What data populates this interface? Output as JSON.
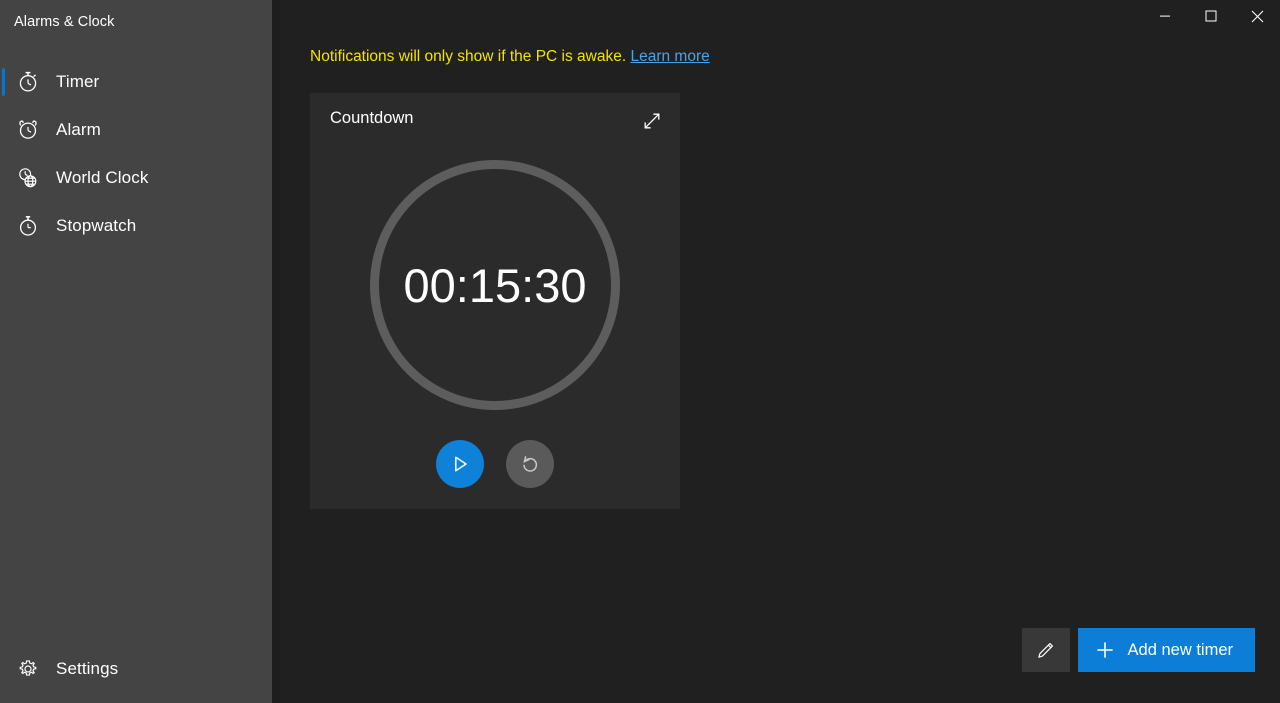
{
  "app": {
    "title": "Alarms & Clock",
    "accent_color": "#0078d7",
    "window_background": "#202020",
    "sidebar_background": "#444444",
    "card_background": "#2b2b2b"
  },
  "window_controls": {
    "minimize": {
      "name": "minimize",
      "glyph": "minimize-icon"
    },
    "maximize": {
      "name": "maximize",
      "glyph": "maximize-icon"
    },
    "close": {
      "name": "close",
      "glyph": "close-icon"
    }
  },
  "sidebar": {
    "items": [
      {
        "label": "Timer",
        "icon": "timer-icon",
        "selected": true
      },
      {
        "label": "Alarm",
        "icon": "alarm-icon",
        "selected": false
      },
      {
        "label": "World Clock",
        "icon": "world-clock-icon",
        "selected": false
      },
      {
        "label": "Stopwatch",
        "icon": "stopwatch-icon",
        "selected": false
      }
    ],
    "settings": {
      "label": "Settings",
      "icon": "gear-icon"
    }
  },
  "banner": {
    "message": "Notifications will only show if the PC is awake.",
    "link_label": "Learn more",
    "text_color": "#f2e300",
    "link_color": "#4aa3e8"
  },
  "timer_card": {
    "title": "Countdown",
    "time": "00:15:30",
    "expand_icon": "expand-icon",
    "ring_color": "#5d5d5d",
    "controls": {
      "play": {
        "label": "Start",
        "icon": "play-icon",
        "color": "#0d82d8"
      },
      "reset": {
        "label": "Reset",
        "icon": "reset-icon",
        "color": "#5a5a5a"
      }
    }
  },
  "bottom_actions": {
    "edit": {
      "label": "Edit",
      "icon": "pencil-icon"
    },
    "add": {
      "label": "Add new timer",
      "icon": "plus-icon",
      "color": "#0d7ed8"
    }
  }
}
